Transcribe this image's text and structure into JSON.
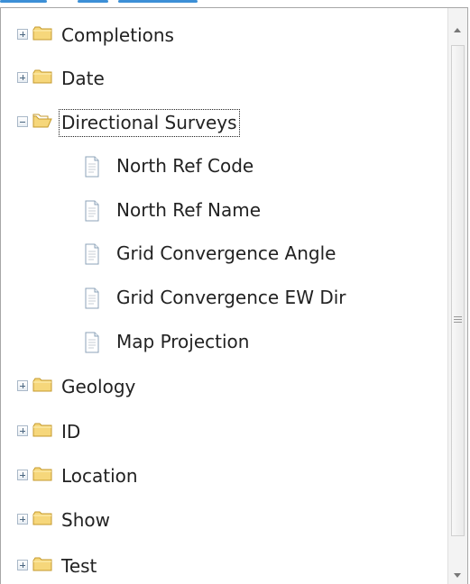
{
  "tree": {
    "rows": [
      {
        "type": "folder",
        "state": "collapsed",
        "label": "Completions"
      },
      {
        "type": "folder",
        "state": "collapsed",
        "label": "Date"
      },
      {
        "type": "folder",
        "state": "expanded",
        "selected": true,
        "label": "Directional Surveys"
      },
      {
        "type": "file",
        "label": "North Ref Code"
      },
      {
        "type": "file",
        "label": "North Ref Name"
      },
      {
        "type": "file",
        "label": "Grid Convergence Angle"
      },
      {
        "type": "file",
        "label": "Grid Convergence EW Dir"
      },
      {
        "type": "file",
        "label": "Map Projection"
      },
      {
        "type": "folder",
        "state": "collapsed",
        "label": "Geology"
      },
      {
        "type": "folder",
        "state": "collapsed",
        "label": "ID"
      },
      {
        "type": "folder",
        "state": "collapsed",
        "label": "Location"
      },
      {
        "type": "folder",
        "state": "collapsed",
        "label": "Show"
      },
      {
        "type": "folder",
        "state": "collapsed",
        "label": "Test"
      }
    ]
  },
  "icons": {
    "folder_closed": "folder-icon",
    "folder_open": "folder-open-icon",
    "file": "document-icon",
    "plus": "plus-expander-icon",
    "minus": "minus-expander-icon"
  },
  "colors": {
    "folder_fill": "#f6d77b",
    "folder_stroke": "#c49a2c",
    "file_stroke": "#8da3b8",
    "text": "#222222",
    "border": "#a7a7a7"
  }
}
